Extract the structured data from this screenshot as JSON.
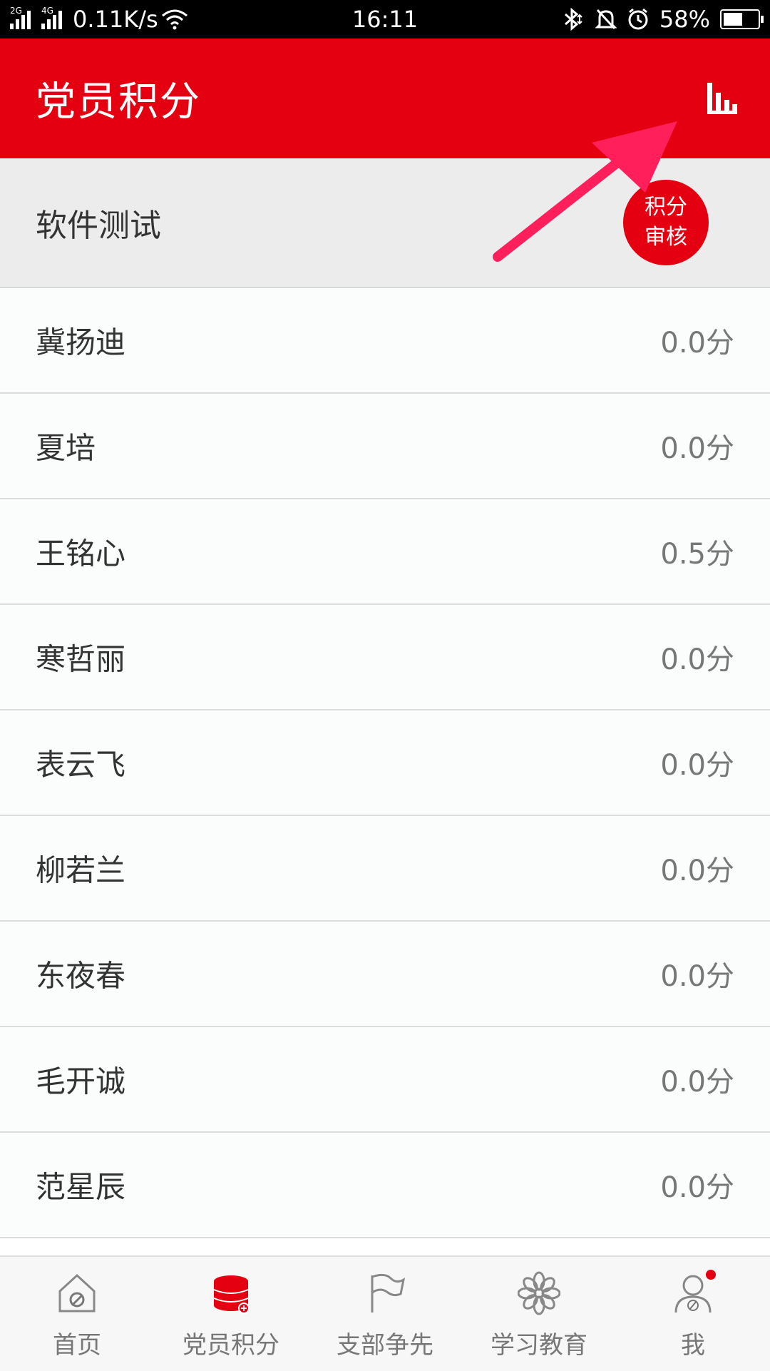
{
  "status_bar": {
    "net1": "2G",
    "net2": "4G",
    "speed": "0.11K/s",
    "time": "16:11",
    "battery_percent": "58%",
    "battery_level": 0.58
  },
  "header": {
    "title": "党员积分",
    "chart_icon": "bar-chart-icon"
  },
  "group": {
    "name": "软件测试",
    "badge_line1": "积分",
    "badge_line2": "审核"
  },
  "members": [
    {
      "name": "冀扬迪",
      "score": "0.0分"
    },
    {
      "name": "夏培",
      "score": "0.0分"
    },
    {
      "name": "王铭心",
      "score": "0.5分"
    },
    {
      "name": "寒哲丽",
      "score": "0.0分"
    },
    {
      "name": "表云飞",
      "score": "0.0分"
    },
    {
      "name": "柳若兰",
      "score": "0.0分"
    },
    {
      "name": "东夜春",
      "score": "0.0分"
    },
    {
      "name": "毛开诚",
      "score": "0.0分"
    },
    {
      "name": "范星辰",
      "score": "0.0分"
    }
  ],
  "tabs": [
    {
      "label": "首页",
      "icon": "home-icon"
    },
    {
      "label": "党员积分",
      "icon": "coins-icon"
    },
    {
      "label": "支部争先",
      "icon": "flag-icon"
    },
    {
      "label": "学习教育",
      "icon": "flower-icon"
    },
    {
      "label": "我",
      "icon": "profile-icon"
    }
  ],
  "colors": {
    "accent": "#e50011",
    "annotation_arrow": "#ff1f5a"
  }
}
